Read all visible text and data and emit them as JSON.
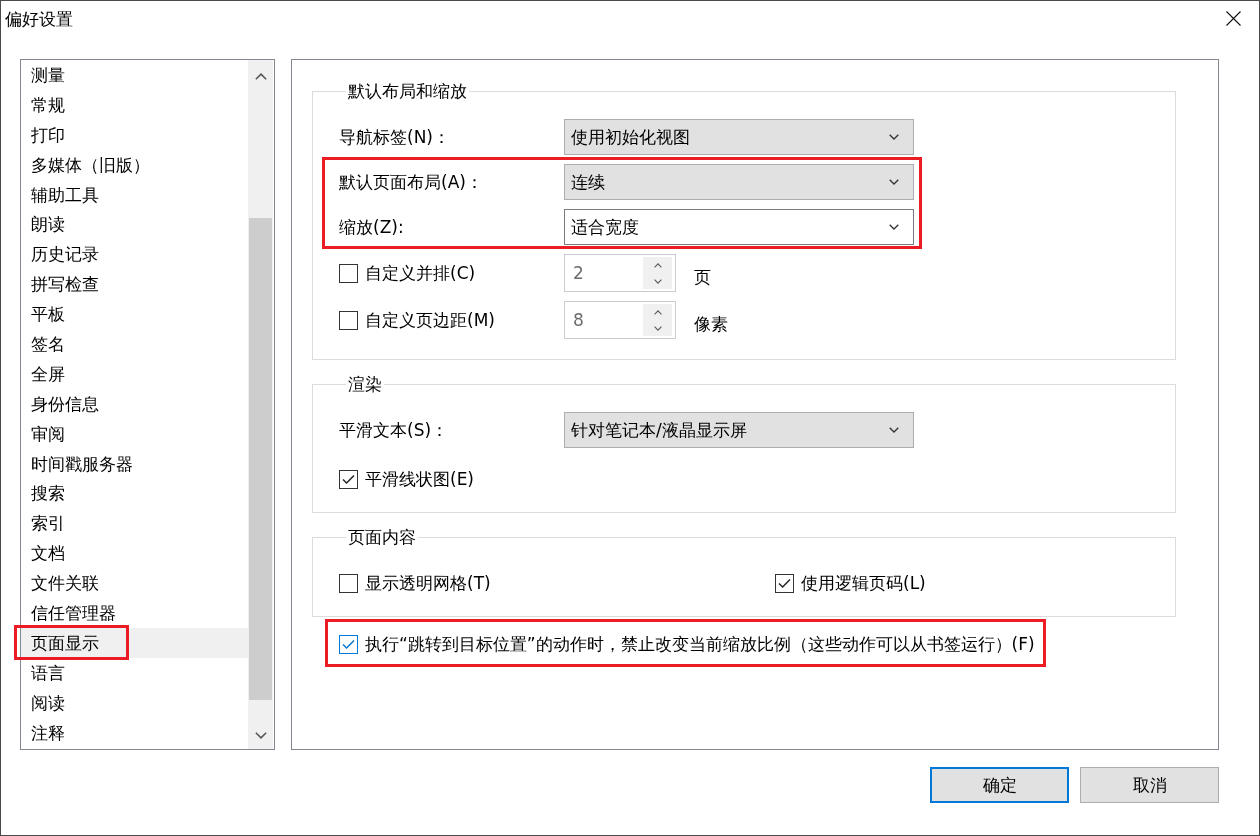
{
  "window": {
    "title": "偏好设置"
  },
  "sidebar": {
    "items": [
      {
        "label": "测量",
        "selected": false,
        "highlighted": false
      },
      {
        "label": "常规",
        "selected": false,
        "highlighted": false
      },
      {
        "label": "打印",
        "selected": false,
        "highlighted": false
      },
      {
        "label": "多媒体（旧版）",
        "selected": false,
        "highlighted": false
      },
      {
        "label": "辅助工具",
        "selected": false,
        "highlighted": false
      },
      {
        "label": "朗读",
        "selected": false,
        "highlighted": false
      },
      {
        "label": "历史记录",
        "selected": false,
        "highlighted": false
      },
      {
        "label": "拼写检查",
        "selected": false,
        "highlighted": false
      },
      {
        "label": "平板",
        "selected": false,
        "highlighted": false
      },
      {
        "label": "签名",
        "selected": false,
        "highlighted": false
      },
      {
        "label": "全屏",
        "selected": false,
        "highlighted": false
      },
      {
        "label": "身份信息",
        "selected": false,
        "highlighted": false
      },
      {
        "label": "审阅",
        "selected": false,
        "highlighted": false
      },
      {
        "label": "时间戳服务器",
        "selected": false,
        "highlighted": false
      },
      {
        "label": "搜索",
        "selected": false,
        "highlighted": false
      },
      {
        "label": "索引",
        "selected": false,
        "highlighted": false
      },
      {
        "label": "文档",
        "selected": false,
        "highlighted": false
      },
      {
        "label": "文件关联",
        "selected": false,
        "highlighted": false
      },
      {
        "label": "信任管理器",
        "selected": false,
        "highlighted": false
      },
      {
        "label": "页面显示",
        "selected": true,
        "highlighted": true
      },
      {
        "label": "语言",
        "selected": false,
        "highlighted": false
      },
      {
        "label": "阅读",
        "selected": false,
        "highlighted": false
      },
      {
        "label": "注释",
        "selected": false,
        "highlighted": false
      }
    ]
  },
  "sections": [
    {
      "title": "默认布局和缩放",
      "rows": [
        {
          "kind": "dropdown",
          "label": "导航标签(N)：",
          "value": "使用初始化视图",
          "highlighted": false
        },
        {
          "kind": "dropdown",
          "label": "默认页面布局(A)：",
          "value": "连续",
          "highlighted": true
        },
        {
          "kind": "combo",
          "label": "缩放(Z):",
          "value": "适合宽度",
          "highlighted": true
        },
        {
          "kind": "spin",
          "label": "自定义并排(C)",
          "checked": false,
          "disabled": true,
          "value": "2",
          "unit": "页",
          "highlighted": false
        },
        {
          "kind": "spin",
          "label": "自定义页边距(M)",
          "checked": false,
          "disabled": true,
          "value": "8",
          "unit": "像素",
          "highlighted": false
        }
      ]
    },
    {
      "title": "渲染",
      "rows": [
        {
          "kind": "dropdown",
          "label": "平滑文本(S)：",
          "value": "针对笔记本/液晶显示屏",
          "highlighted": false
        },
        {
          "kind": "checkboxes",
          "items": [
            {
              "label": "平滑线状图(E)",
              "checked": true
            }
          ],
          "highlighted": false
        }
      ]
    },
    {
      "title": "页面内容",
      "rows": [
        {
          "kind": "checkboxes",
          "items": [
            {
              "label": "显示透明网格(T)",
              "checked": false
            },
            {
              "label": "使用逻辑页码(L)",
              "checked": true
            }
          ],
          "highlighted": false
        }
      ]
    }
  ],
  "footer_option": {
    "label": "执行“跳转到目标位置”的动作时，禁止改变当前缩放比例（这些动作可以从书签运行）(F)",
    "checked": true,
    "focused": true,
    "highlighted": true
  },
  "buttons": [
    {
      "label": "确定",
      "default": true
    },
    {
      "label": "取消",
      "default": false
    }
  ]
}
